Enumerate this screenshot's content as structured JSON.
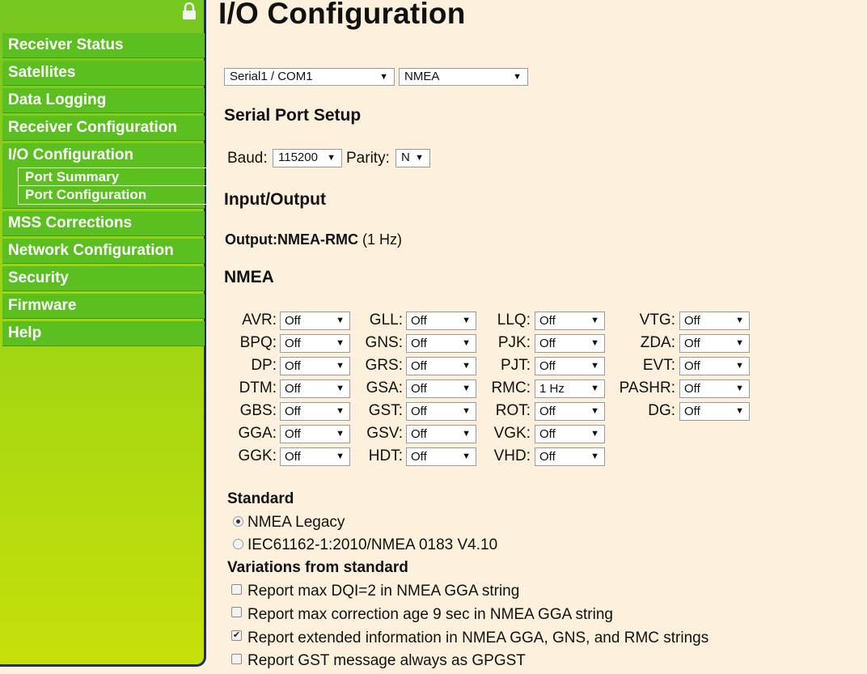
{
  "sidebar": {
    "items": [
      {
        "label": "Receiver Status"
      },
      {
        "label": "Satellites"
      },
      {
        "label": "Data Logging"
      },
      {
        "label": "Receiver Configuration"
      },
      {
        "label": "I/O Configuration",
        "sub": [
          "Port Summary",
          "Port Configuration"
        ]
      },
      {
        "label": "MSS Corrections"
      },
      {
        "label": "Network Configuration"
      },
      {
        "label": "Security"
      },
      {
        "label": "Firmware"
      },
      {
        "label": "Help"
      }
    ]
  },
  "page_title": "I/O Configuration",
  "port_select": "Serial1 / COM1",
  "protocol_select": "NMEA",
  "serial_setup": {
    "heading": "Serial Port Setup",
    "baud_label": "Baud:",
    "baud_value": "115200",
    "parity_label": "Parity:",
    "parity_value": "N"
  },
  "io": {
    "heading": "Input/Output",
    "output_label": "Output:NMEA-RMC",
    "output_rate": "(1 Hz)"
  },
  "nmea": {
    "heading": "NMEA",
    "columns": [
      [
        {
          "label": "AVR:",
          "value": "Off"
        },
        {
          "label": "BPQ:",
          "value": "Off"
        },
        {
          "label": "DP:",
          "value": "Off"
        },
        {
          "label": "DTM:",
          "value": "Off"
        },
        {
          "label": "GBS:",
          "value": "Off"
        },
        {
          "label": "GGA:",
          "value": "Off"
        },
        {
          "label": "GGK:",
          "value": "Off"
        }
      ],
      [
        {
          "label": "GLL:",
          "value": "Off"
        },
        {
          "label": "GNS:",
          "value": "Off"
        },
        {
          "label": "GRS:",
          "value": "Off"
        },
        {
          "label": "GSA:",
          "value": "Off"
        },
        {
          "label": "GST:",
          "value": "Off"
        },
        {
          "label": "GSV:",
          "value": "Off"
        },
        {
          "label": "HDT:",
          "value": "Off"
        }
      ],
      [
        {
          "label": "LLQ:",
          "value": "Off"
        },
        {
          "label": "PJK:",
          "value": "Off"
        },
        {
          "label": "PJT:",
          "value": "Off"
        },
        {
          "label": "RMC:",
          "value": "1 Hz"
        },
        {
          "label": "ROT:",
          "value": "Off"
        },
        {
          "label": "VGK:",
          "value": "Off"
        },
        {
          "label": "VHD:",
          "value": "Off"
        }
      ],
      [
        {
          "label": "VTG:",
          "value": "Off"
        },
        {
          "label": "ZDA:",
          "value": "Off"
        },
        {
          "label": "EVT:",
          "value": "Off"
        },
        {
          "label": "PASHR:",
          "value": "Off"
        },
        {
          "label": "DG:",
          "value": "Off"
        }
      ]
    ]
  },
  "standard": {
    "heading": "Standard",
    "options": [
      {
        "label": "NMEA Legacy",
        "selected": true
      },
      {
        "label": "IEC61162-1:2010/NMEA 0183 V4.10",
        "selected": false
      }
    ]
  },
  "variations": {
    "heading": "Variations from standard",
    "options": [
      {
        "label": "Report max DQI=2 in NMEA GGA string",
        "checked": false
      },
      {
        "label": "Report max correction age 9 sec in NMEA GGA string",
        "checked": false
      },
      {
        "label": "Report extended information in NMEA GGA, GNS, and RMC strings",
        "checked": true
      },
      {
        "label": "Report GST message always as GPGST",
        "checked": false
      }
    ]
  }
}
